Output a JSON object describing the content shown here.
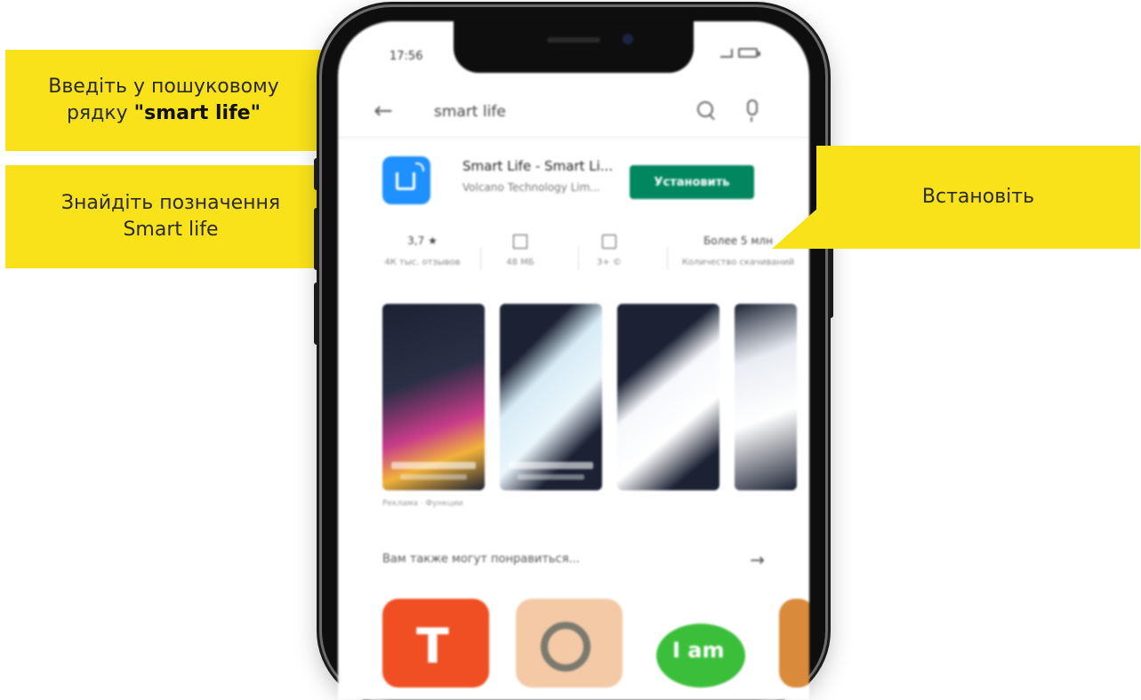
{
  "callouts": {
    "search": {
      "line1": "Введіть у пошуковому",
      "line2_prefix": "рядку ",
      "line2_bold": "\"smart life\""
    },
    "find": {
      "line1": "Знайдіть позначення",
      "line2": "Smart life"
    },
    "install": {
      "text": "Встановіть"
    }
  },
  "phone": {
    "status_time": "17:56",
    "search": {
      "query": "smart life"
    },
    "app": {
      "name": "Smart Life - Smart Li...",
      "developer": "Volcano Technology Lim...",
      "install_label": "Установить"
    },
    "stats": [
      {
        "value": "3,7 ★",
        "label": "4К тыс. отзывов"
      },
      {
        "value": "",
        "label": "48 МБ"
      },
      {
        "value": "",
        "label": "3+ ©"
      },
      {
        "value": "Более 5 млн",
        "label": "Количество скачиваний"
      }
    ],
    "shots_note": "Реклама · Функции",
    "also_like": "Вам также могут понравиться...",
    "also_arrow": "→",
    "rec_apps": [
      "T",
      "",
      "I am"
    ]
  },
  "colors": {
    "callout": "#f9e21a",
    "install_button": "#01875f",
    "app_icon": "#1e90ff"
  }
}
